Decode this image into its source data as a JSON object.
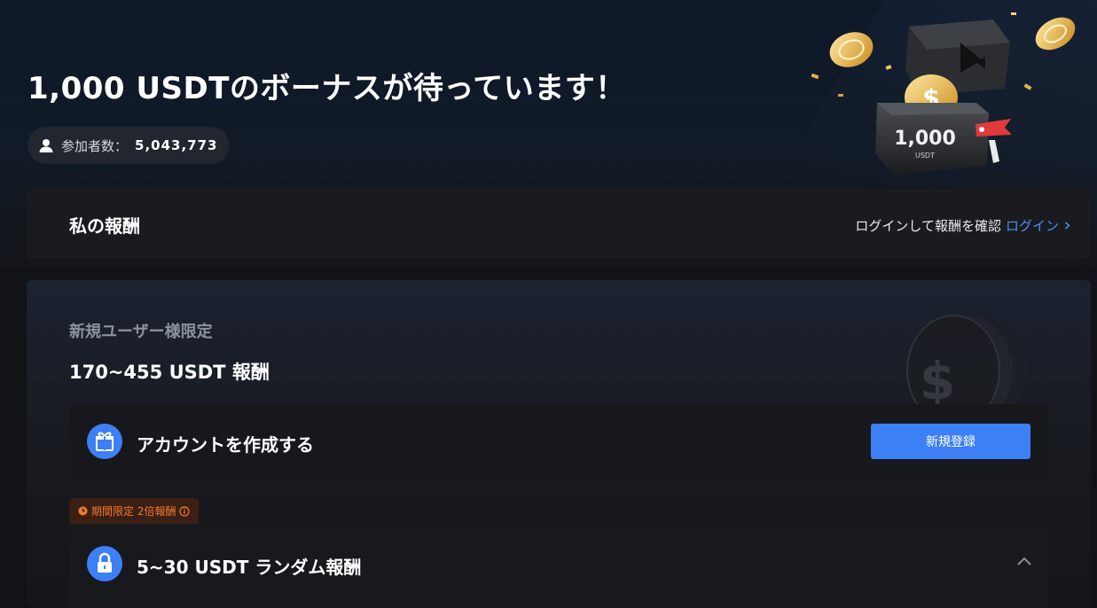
{
  "hero": {
    "title": "1,000 USDTのボーナスが待っています！",
    "participants_label": "参加者数：",
    "participants_count": "5,043,773",
    "chest_amount": "1,000",
    "chest_unit": "USDT"
  },
  "rewards": {
    "title": "私の報酬",
    "login_prompt": "ログインして報酬を確認",
    "login_link": "ログイン"
  },
  "new_user": {
    "subtitle": "新規ユーザー様限定",
    "amount": "170~455 USDT 報酬",
    "task1": {
      "title": "アカウントを作成する",
      "button": "新規登録"
    },
    "badge": "期間限定 2倍報酬",
    "task2": {
      "title": "5~30 USDT ランダム報酬"
    }
  },
  "colors": {
    "accent": "#3d7ff5",
    "link": "#4b8ff5",
    "badge_text": "#f5782f",
    "badge_bg": "#3a2014"
  }
}
